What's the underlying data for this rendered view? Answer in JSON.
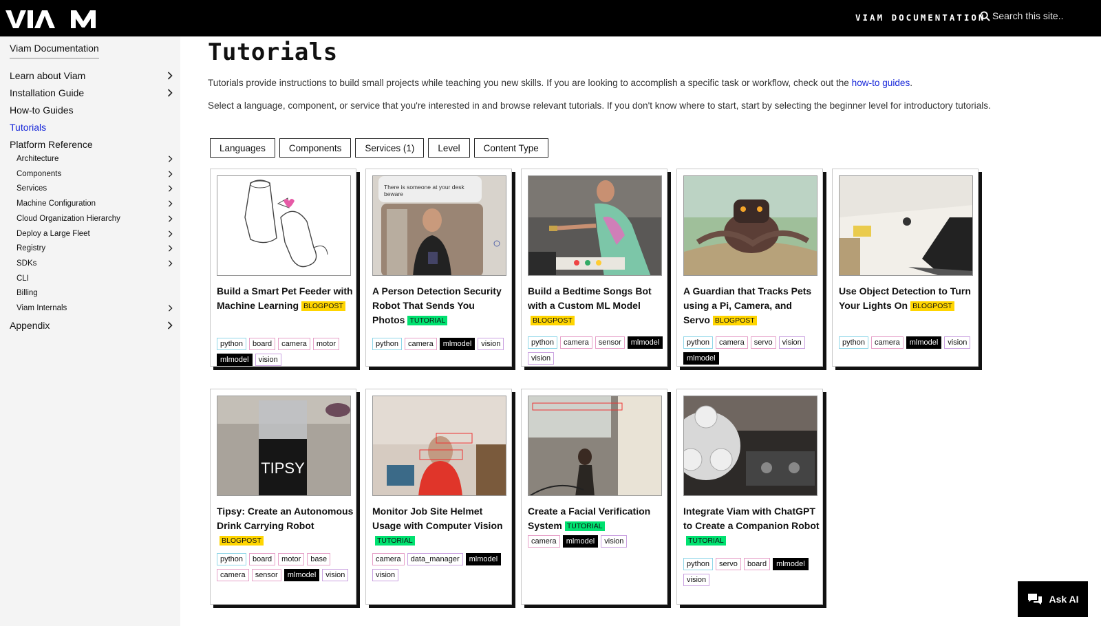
{
  "header": {
    "brand": "VIAM",
    "docs_link": "VIAM DOCUMENTATION",
    "search_placeholder": "Search this site.."
  },
  "sidebar": {
    "home": "Viam Documentation",
    "items": [
      {
        "label": "Learn about Viam",
        "expandable": true
      },
      {
        "label": "Installation Guide",
        "expandable": true
      },
      {
        "label": "How-to Guides",
        "expandable": false
      },
      {
        "label": "Tutorials",
        "expandable": false,
        "active": true
      },
      {
        "label": "Platform Reference",
        "expandable": false
      }
    ],
    "subitems": [
      {
        "label": "Architecture",
        "expandable": true
      },
      {
        "label": "Components",
        "expandable": true
      },
      {
        "label": "Services",
        "expandable": true
      },
      {
        "label": "Machine Configuration",
        "expandable": true
      },
      {
        "label": "Cloud Organization Hierarchy",
        "expandable": true
      },
      {
        "label": "Deploy a Large Fleet",
        "expandable": true
      },
      {
        "label": "Registry",
        "expandable": true
      },
      {
        "label": "SDKs",
        "expandable": true
      },
      {
        "label": "CLI",
        "expandable": false
      },
      {
        "label": "Billing",
        "expandable": false
      },
      {
        "label": "Viam Internals",
        "expandable": true
      }
    ],
    "appendix": "Appendix"
  },
  "main": {
    "title": "Tutorials",
    "intro1_text": "Tutorials provide instructions to build small projects while teaching you new skills. If you are looking to accomplish a specific task or workflow, check out the ",
    "intro1_link": "how-to guides",
    "intro1_end": ".",
    "intro2": "Select a language, component, or service that you're interested in and browse relevant tutorials. If you don't know where to start, start by selecting the beginner level for introductory tutorials.",
    "filters": [
      "Languages",
      "Components",
      "Services (1)",
      "Level",
      "Content Type"
    ]
  },
  "cards": [
    {
      "title": "Build a Smart Pet Feeder with Machine Learning",
      "badge": "BLOGPOST",
      "tags": [
        "python",
        "board",
        "camera",
        "motor",
        "mlmodel",
        "vision"
      ]
    },
    {
      "title": "A Person Detection Security Robot That Sends You Photos",
      "badge": "TUTORIAL",
      "tags": [
        "python",
        "camera",
        "mlmodel",
        "vision"
      ],
      "image_caption": "There is someone at your desk beware"
    },
    {
      "title": "Build a Bedtime Songs Bot with a Custom ML Model",
      "badge": "BLOGPOST",
      "tags": [
        "python",
        "camera",
        "sensor",
        "mlmodel",
        "vision"
      ]
    },
    {
      "title": "A Guardian that Tracks Pets using a Pi, Camera, and Servo",
      "badge": "BLOGPOST",
      "tags": [
        "python",
        "camera",
        "servo",
        "vision",
        "mlmodel"
      ]
    },
    {
      "title": "Use Object Detection to Turn Your Lights On",
      "badge": "BLOGPOST",
      "tags": [
        "python",
        "camera",
        "mlmodel",
        "vision"
      ]
    },
    {
      "title": "Tipsy: Create an Autonomous Drink Carrying Robot",
      "badge": "BLOGPOST",
      "tags": [
        "python",
        "board",
        "motor",
        "base",
        "camera",
        "sensor",
        "mlmodel",
        "vision"
      ],
      "image_caption": "TIPSY"
    },
    {
      "title": "Monitor Job Site Helmet Usage with Computer Vision",
      "badge": "TUTORIAL",
      "tags": [
        "camera",
        "data_manager",
        "mlmodel",
        "vision"
      ]
    },
    {
      "title": "Create a Facial Verification System",
      "badge": "TUTORIAL",
      "tags": [
        "camera",
        "mlmodel",
        "vision"
      ]
    },
    {
      "title": "Integrate Viam with ChatGPT to Create a Companion Robot",
      "badge": "TUTORIAL",
      "tags": [
        "python",
        "servo",
        "board",
        "mlmodel",
        "vision"
      ]
    }
  ],
  "ask_ai": "Ask AI"
}
